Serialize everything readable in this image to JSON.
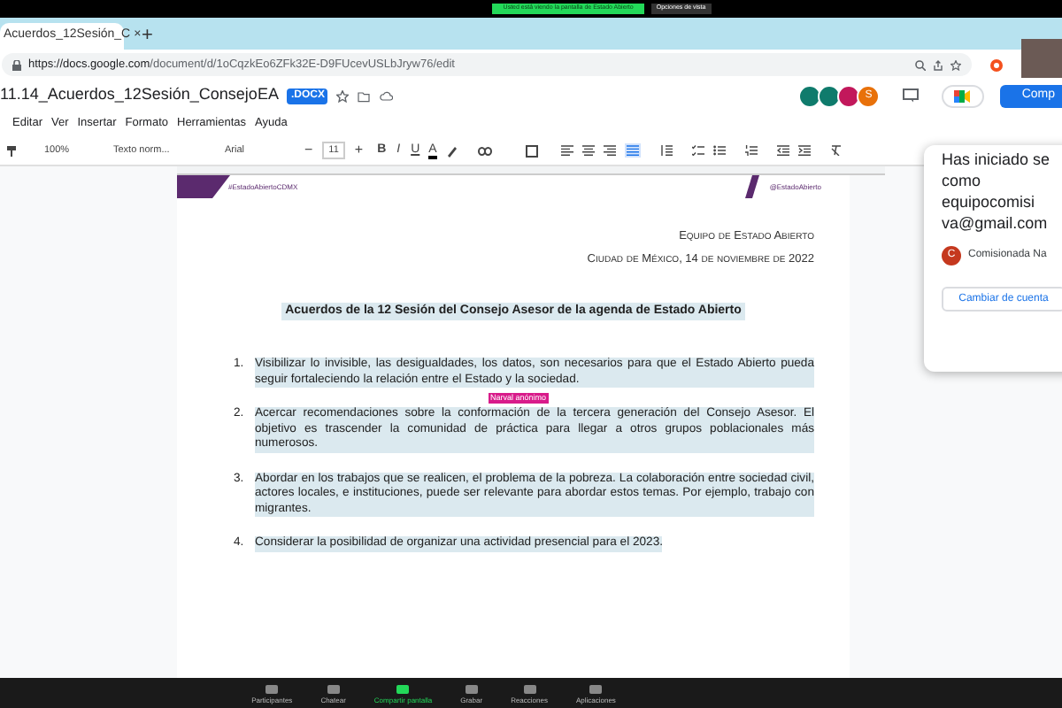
{
  "zoom_banner": {
    "viewing": "Usted está viendo la pantalla de Estado Abierto",
    "view_options": "Opciones de vista"
  },
  "browser_tab": {
    "title": "Acuerdos_12Sesión_C",
    "close": "×",
    "new_tab": "+"
  },
  "address_bar": {
    "host": "https://docs.google.com",
    "path": "/document/d/1oCqzkEo6ZFk32E-D9FUcevUSLbJryw76/edit"
  },
  "doc_header": {
    "title": "11.14_Acuerdos_12Sesión_ConsejoEA",
    "format_badge": ".DOCX",
    "collaborators": [
      {
        "color": "#0f7b6c"
      },
      {
        "color": "#0f7b6c"
      },
      {
        "color": "#c2185b"
      },
      {
        "initial": "S",
        "color": "#e8710a"
      }
    ],
    "share_button": "Comp"
  },
  "menu": [
    "Editar",
    "Ver",
    "Insertar",
    "Formato",
    "Herramientas",
    "Ayuda"
  ],
  "toolbar": {
    "zoom": "100%",
    "style": "Texto norm...",
    "font": "Arial",
    "size": "11",
    "decrease": "−",
    "increase": "+",
    "bold": "B",
    "italic": "I",
    "underline": "U",
    "text_color": "A"
  },
  "page_banner": {
    "hashtag": "#EstadoAbiertoCDMX",
    "handle": "@EstadoAbierto"
  },
  "document": {
    "team": "Equipo de Estado Abierto",
    "date_line": "Ciudad de México, 14 de noviembre de 2022",
    "heading": "Acuerdos de la 12 Sesión del Consejo Asesor de la agenda de Estado Abierto",
    "items": [
      {
        "number": "1.",
        "text": "Visibilizar lo invisible, las desigualdades, los datos, son necesarios para que el Estado Abierto pueda seguir fortaleciendo la relación entre el Estado y la sociedad."
      },
      {
        "number": "2.",
        "text": "Acercar recomendaciones sobre la conformación de la tercera generación del Consejo Asesor. El objetivo es trascender la comunidad de práctica para llegar a otros grupos poblacionales más numerosos."
      },
      {
        "number": "3.",
        "text": "Abordar en los trabajos que se realicen, el problema de la pobreza. La colaboración entre sociedad civil, actores locales, e instituciones, puede ser relevante para abordar estos temas. Por ejemplo, trabajo con migrantes."
      },
      {
        "number": "4.",
        "text": "Considerar la posibilidad de organizar una actividad presencial para el 2023."
      }
    ],
    "cursor_label": "Narval anónimo"
  },
  "account_popup": {
    "lines": [
      "Has iniciado se",
      "como",
      "equipocomisi",
      "va@gmail.com"
    ],
    "avatar_initial": "C",
    "account_name": "Comisionada Na",
    "switch_button": "Cambiar de cuenta"
  },
  "meeting_controls": [
    {
      "label": "Participantes",
      "active": false
    },
    {
      "label": "Chatear",
      "active": false
    },
    {
      "label": "Compartir pantalla",
      "active": true
    },
    {
      "label": "Grabar",
      "active": false
    },
    {
      "label": "Reacciones",
      "active": false
    },
    {
      "label": "Aplicaciones",
      "active": false
    }
  ]
}
